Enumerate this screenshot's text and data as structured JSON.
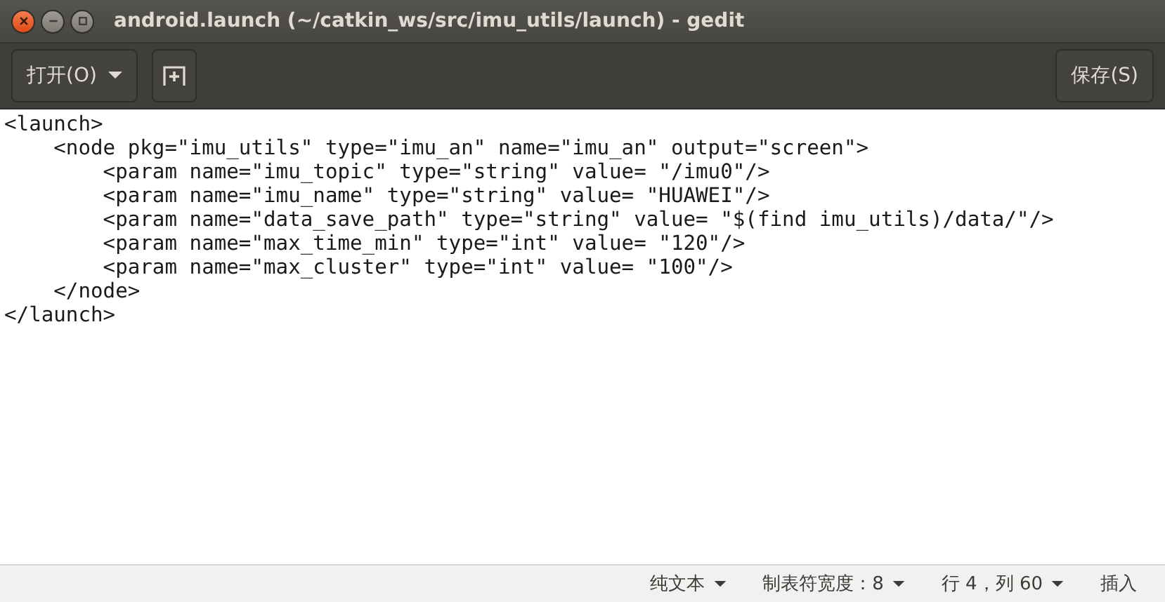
{
  "window": {
    "title": "android.launch (~/catkin_ws/src/imu_utils/launch) - gedit"
  },
  "toolbar": {
    "open_button": "打开(O)",
    "save_button": "保存(S)"
  },
  "editor": {
    "lines": [
      "<launch>",
      "    <node pkg=\"imu_utils\" type=\"imu_an\" name=\"imu_an\" output=\"screen\">",
      "        <param name=\"imu_topic\" type=\"string\" value= \"/imu0\"/>",
      "        <param name=\"imu_name\" type=\"string\" value= \"HUAWEI\"/>",
      "        <param name=\"data_save_path\" type=\"string\" value= \"$(find imu_utils)/data/\"/>",
      "        <param name=\"max_time_min\" type=\"int\" value= \"120\"/>",
      "        <param name=\"max_cluster\" type=\"int\" value= \"100\"/>",
      "    </node>",
      "</launch>"
    ]
  },
  "status_bar": {
    "language": "纯文本",
    "tab_width": "制表符宽度：8",
    "position": "行 4，列 60",
    "mode": "插入"
  }
}
